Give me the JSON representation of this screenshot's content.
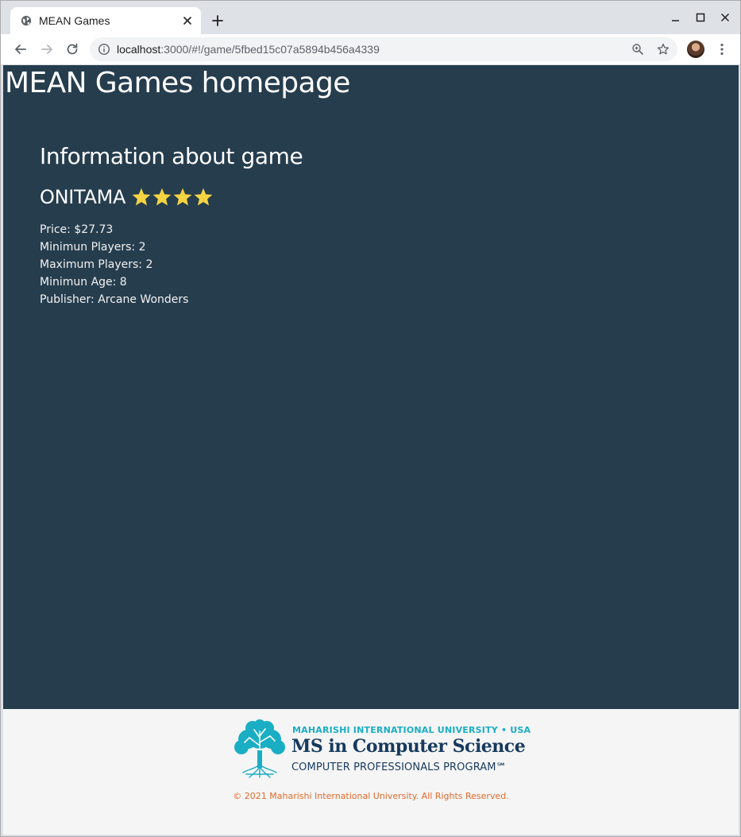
{
  "browser": {
    "tab_title": "MEAN Games",
    "url_host": "localhost",
    "url_path": ":3000/#!/game/5fbed15c07a5894b456a4339",
    "icons": {
      "favicon": "globe-icon",
      "tab_close": "close-icon",
      "new_tab": "plus-icon",
      "minimize": "minimize-icon",
      "maximize": "maximize-icon",
      "close_window": "close-icon",
      "back": "back-arrow-icon",
      "forward": "forward-arrow-icon",
      "reload": "reload-icon",
      "site_info": "info-icon",
      "zoom": "zoom-icon",
      "bookmark": "star-outline-icon",
      "profile": "avatar",
      "menu": "kebab-menu-icon"
    }
  },
  "page": {
    "site_title": "MEAN Games homepage",
    "section_title": "Information about game",
    "game": {
      "name": "ONITAMA",
      "rating": 4,
      "details": [
        "Price: $27.73",
        "Minimun Players: 2",
        "Maximum Players: 2",
        "Minimun Age: 8",
        "Publisher: Arcane Wonders"
      ]
    },
    "footer": {
      "logo_university": "MAHARISHI INTERNATIONAL UNIVERSITY • USA",
      "logo_program": "MS in Computer Science",
      "logo_subtitle": "COMPUTER PROFESSIONALS PROGRAM℠",
      "copyright": "© 2021 Maharishi International University. All Rights Reserved."
    }
  },
  "colors": {
    "main_background": "#263d4e",
    "footer_background": "#f5f5f5",
    "star_color": "#f5d442",
    "copyright_color": "#e06a2c",
    "logo_teal": "#1aaec4",
    "logo_navy": "#173a5e"
  }
}
